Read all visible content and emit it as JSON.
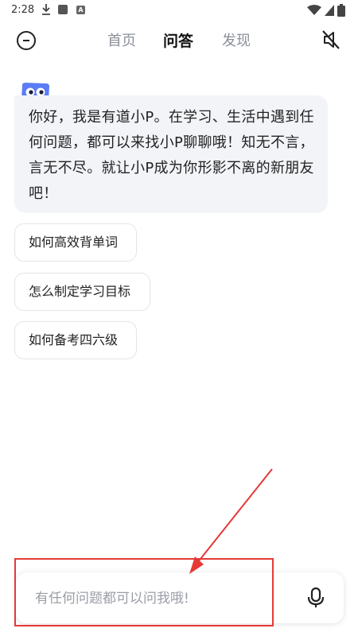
{
  "status_bar": {
    "time": "2:28",
    "icons": [
      "download-icon",
      "app-square-icon",
      "font-a-icon",
      "wifi-icon",
      "signal-icon",
      "battery-icon"
    ]
  },
  "nav": {
    "left_icon": "minus-circle-icon",
    "tabs": [
      {
        "label": "首页",
        "active": false
      },
      {
        "label": "问答",
        "active": true
      },
      {
        "label": "发现",
        "active": false
      }
    ],
    "right_icon": "mute-icon"
  },
  "chat": {
    "avatar_icon": "assistant-avatar-icon",
    "greeting": "你好，我是有道小P。在学习、生活中遇到任何问题，都可以来找小P聊聊哦！知无不言，言无不尽。就让小P成为你形影不离的新朋友吧！",
    "suggestions": [
      "如何高效背单词",
      "怎么制定学习目标",
      "如何备考四六级"
    ]
  },
  "input": {
    "placeholder": "有任何问题都可以问我哦!",
    "mic_icon": "microphone-icon"
  },
  "colors": {
    "accent_text": "#111111",
    "inactive_tab": "#8a8f99",
    "bubble_bg": "#f2f4f8",
    "annotation_red": "#e53935"
  }
}
